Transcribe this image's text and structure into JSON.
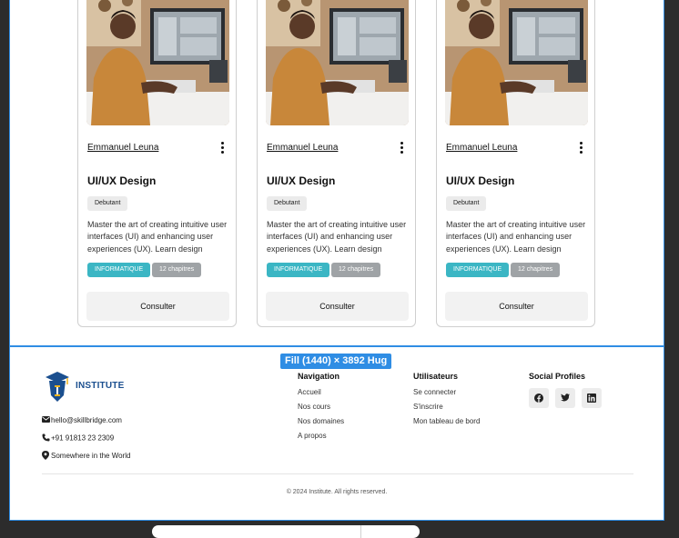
{
  "cards": [
    {
      "author": "Emmanuel Leuna",
      "title": "UI/UX Design",
      "level": "Debutant",
      "description": "Master the art of creating intuitive user interfaces (UI) and enhancing user experiences (UX). Learn design",
      "category": "INFORMATIQUE",
      "chapters": "12 chapitres",
      "button": "Consulter"
    },
    {
      "author": "Emmanuel Leuna",
      "title": "UI/UX Design",
      "level": "Debutant",
      "description": "Master the art of creating intuitive user interfaces (UI) and enhancing user experiences (UX). Learn design",
      "category": "INFORMATIQUE",
      "chapters": "12 chapitres",
      "button": "Consulter"
    },
    {
      "author": "Emmanuel Leuna",
      "title": "UI/UX Design",
      "level": "Debutant",
      "description": "Master the art of creating intuitive user interfaces (UI) and enhancing user experiences (UX). Learn design",
      "category": "INFORMATIQUE",
      "chapters": "12 chapitres",
      "button": "Consulter"
    }
  ],
  "selection_badge": "Fill (1440) × 3892 Hug",
  "footer": {
    "logo_text": "INSTITUTE",
    "email": "hello@skillbridge.com",
    "phone": "+91 91813 23 2309",
    "address": "Somewhere in the World",
    "navigation": {
      "heading": "Navigation",
      "links": [
        "Accueil",
        "Nos cours",
        "Nos domaines",
        "A propos"
      ]
    },
    "users": {
      "heading": "Utilisateurs",
      "links": [
        "Se connecter",
        "S'inscrire",
        "Mon tableau de bord"
      ]
    },
    "social": {
      "heading": "Social Profiles",
      "icons": [
        "facebook-icon",
        "twitter-icon",
        "linkedin-icon"
      ]
    },
    "copyright": "© 2024 Institute. All rights reserved."
  },
  "colors": {
    "selection": "#2f8de4",
    "tag_primary": "#3bb6c4",
    "tag_secondary": "#9fa3a6",
    "brand": "#1b4f8f"
  }
}
